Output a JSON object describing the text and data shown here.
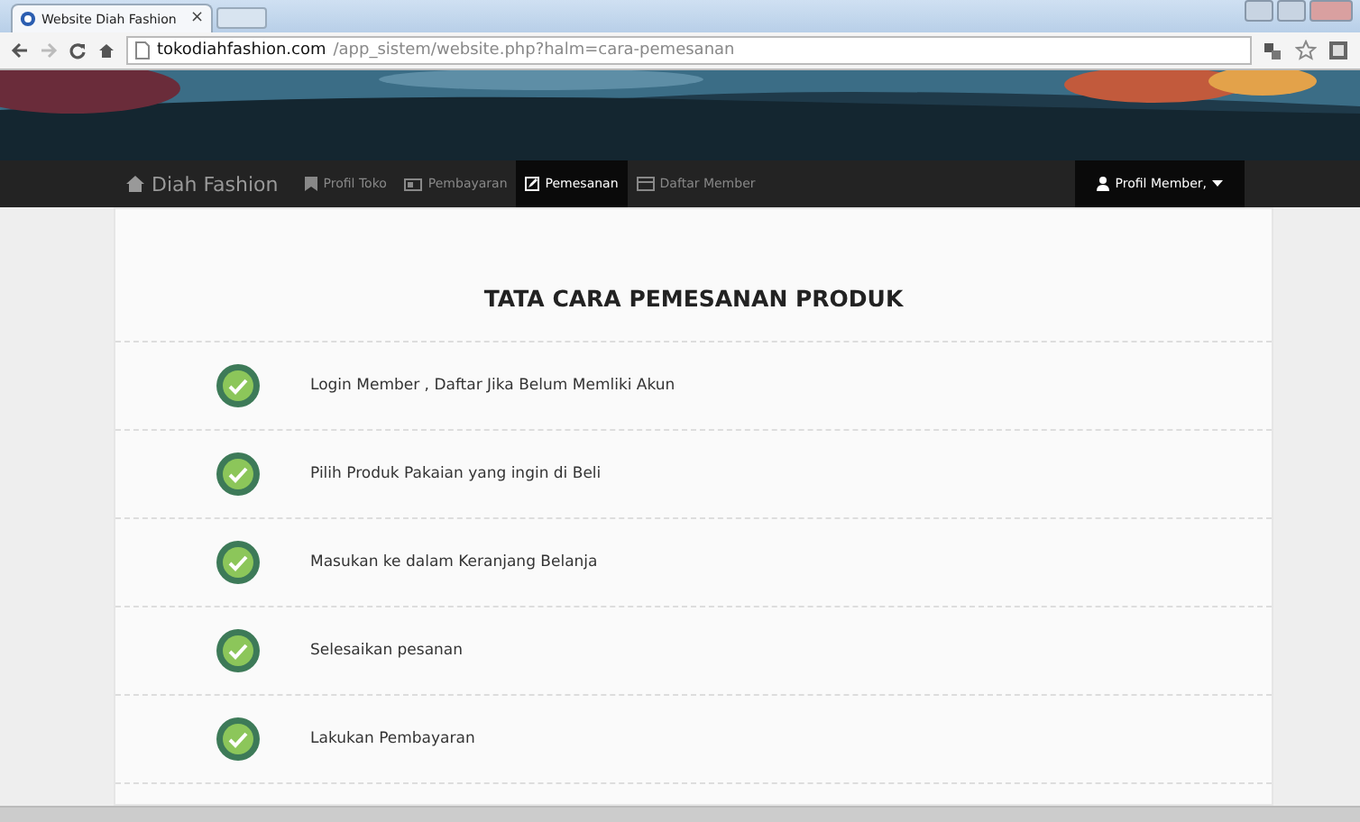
{
  "browser": {
    "tab_title": "Website Diah Fashion",
    "tab_close": "×",
    "url_host": "tokodiahfashion.com",
    "url_path": "/app_sistem/website.php?halm=cara-pemesanan"
  },
  "navbar": {
    "brand": "Diah Fashion",
    "items": [
      {
        "label": "Profil Toko",
        "selected": false
      },
      {
        "label": "Pembayaran",
        "selected": false
      },
      {
        "label": "Pemesanan",
        "selected": true
      },
      {
        "label": "Daftar Member",
        "selected": false
      }
    ],
    "account": {
      "label": "Profil Member,",
      "selected": true
    }
  },
  "content": {
    "title": "TATA CARA PEMESANAN PRODUK",
    "steps": [
      {
        "text": "Login Member , Daftar Jika Belum Memliki Akun",
        "checked": true
      },
      {
        "text": "Pilih Produk Pakaian yang ingin di Beli",
        "checked": true
      },
      {
        "text": "Masukan ke dalam Keranjang Belanja",
        "checked": true
      },
      {
        "text": "Selesaikan pesanan",
        "checked": true
      },
      {
        "text": "Lakukan Pembayaran",
        "checked": true
      }
    ]
  }
}
